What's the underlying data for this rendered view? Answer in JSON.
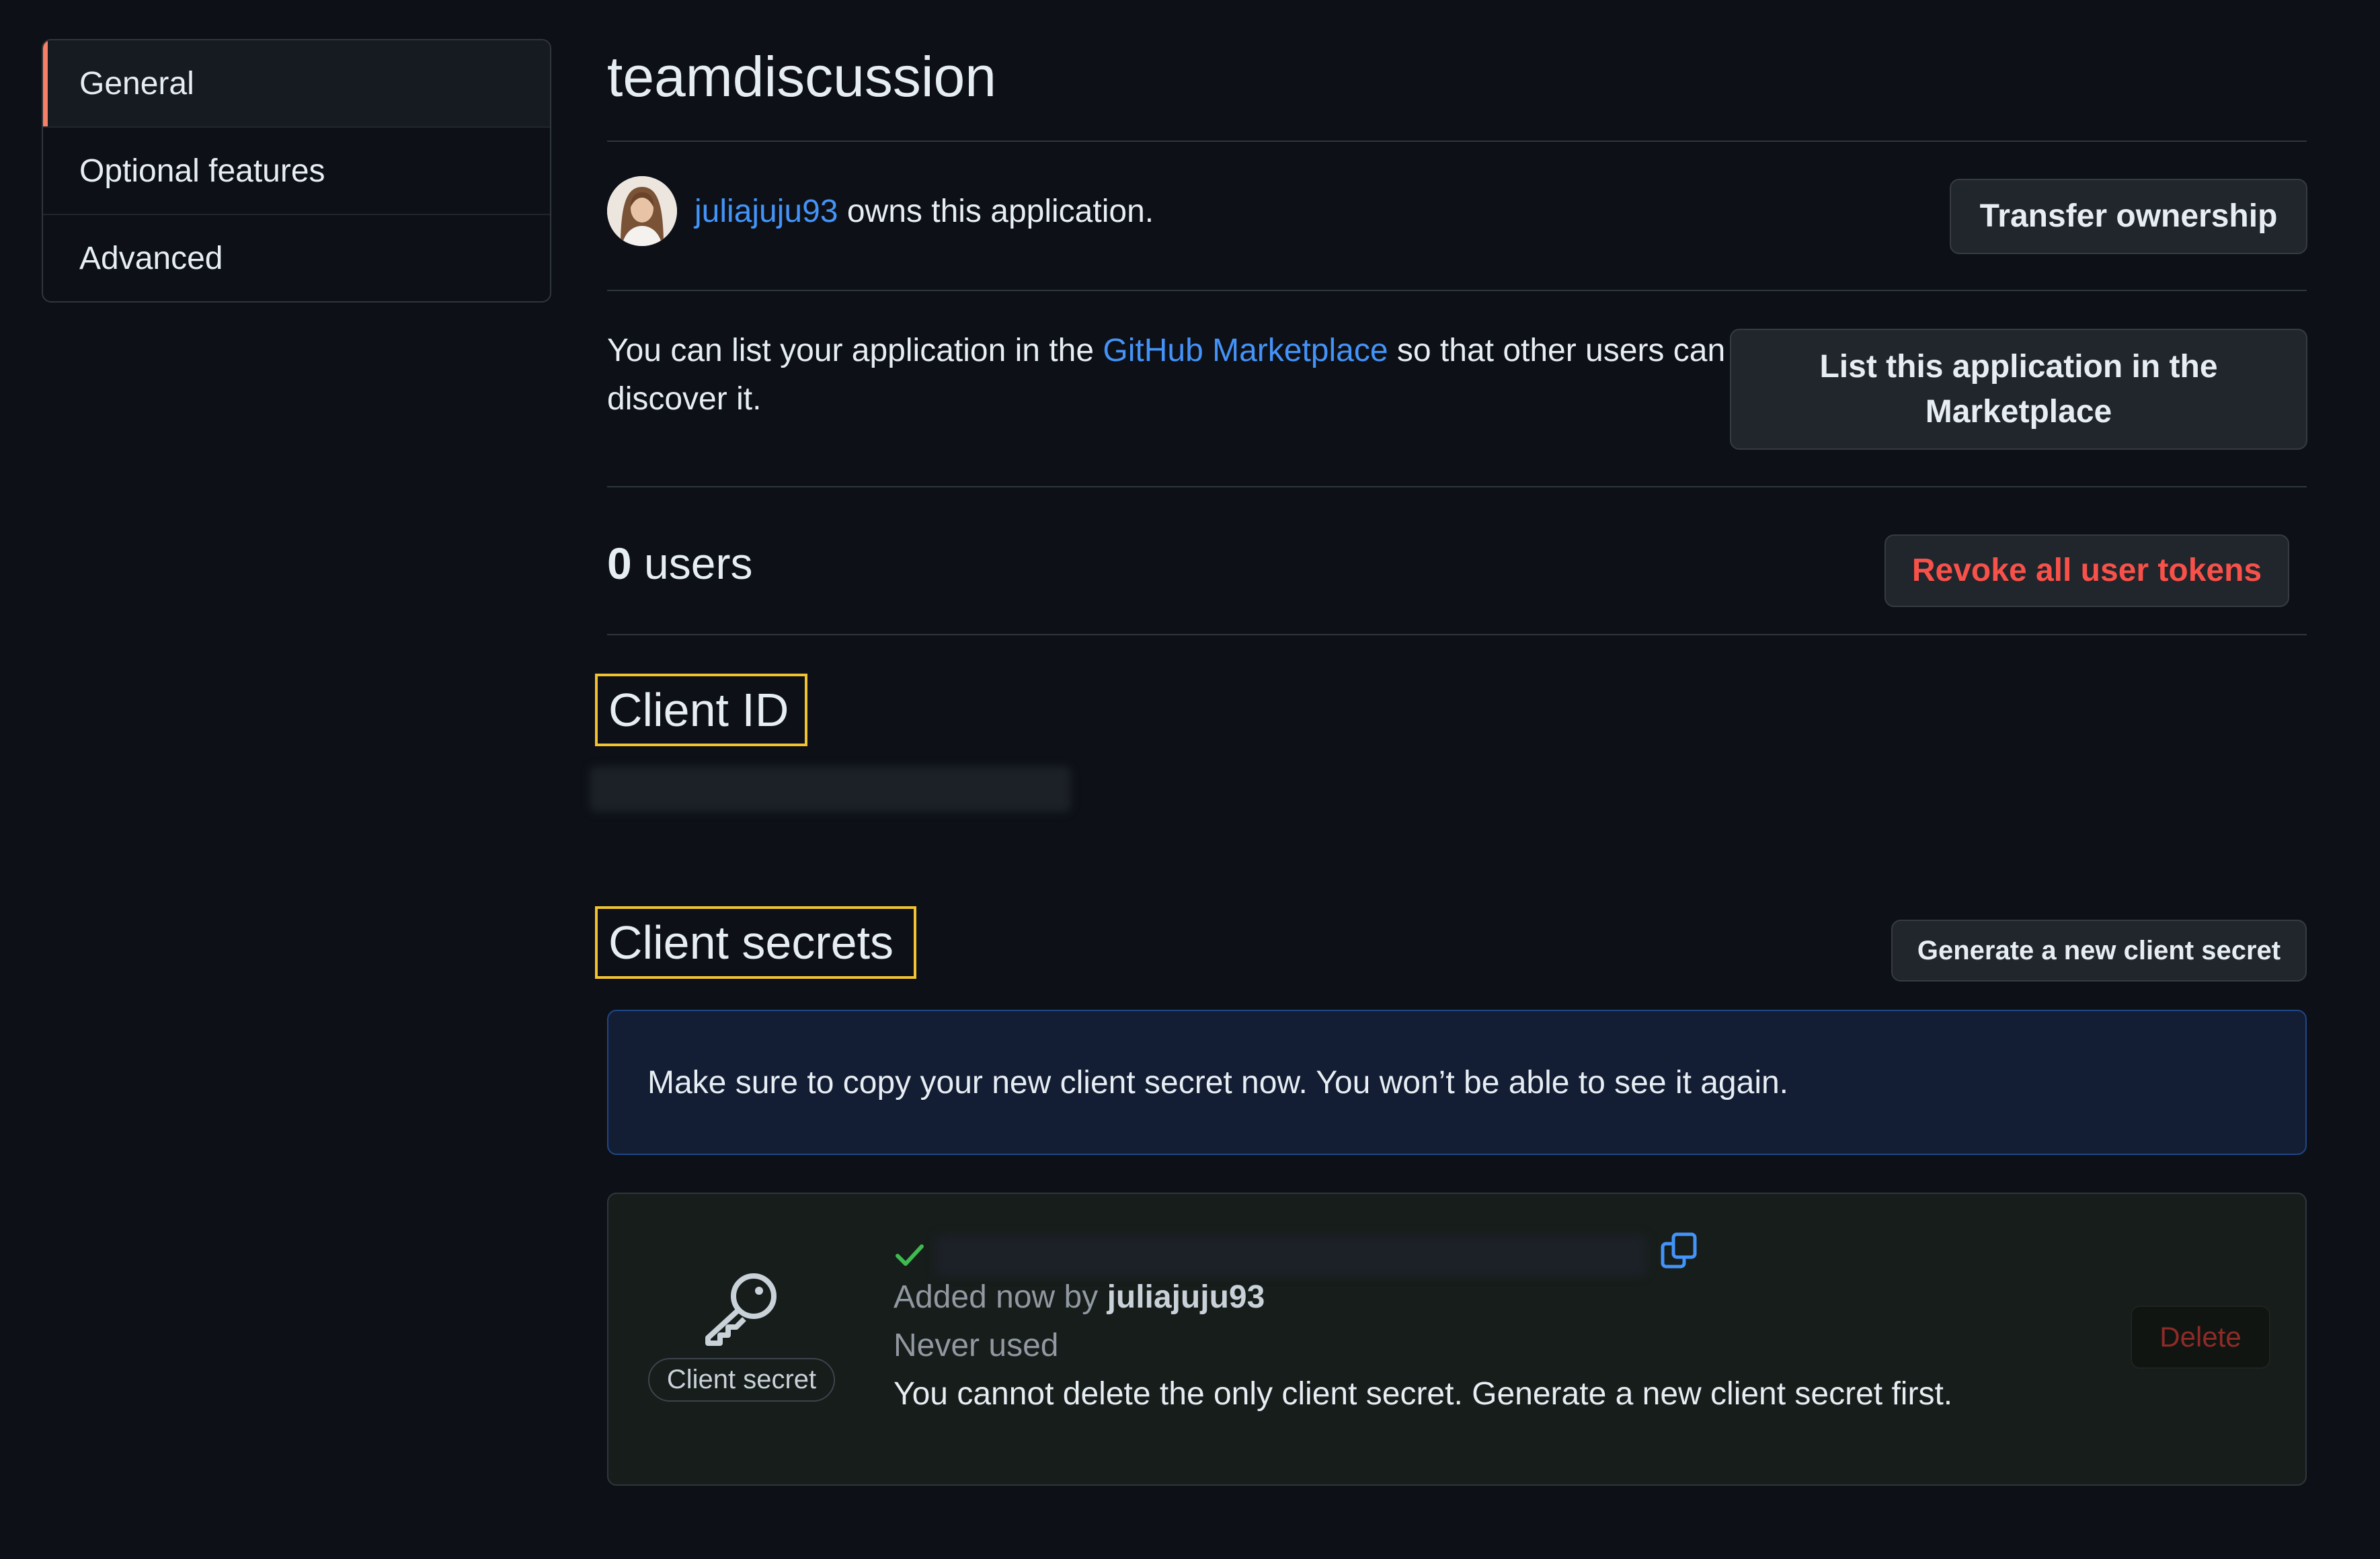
{
  "sidebar": {
    "items": [
      {
        "label": "General"
      },
      {
        "label": "Optional features"
      },
      {
        "label": "Advanced"
      }
    ]
  },
  "app": {
    "title": "teamdiscussion"
  },
  "owner": {
    "username": "juliajuju93",
    "suffix": " owns this application.",
    "transfer_button": "Transfer ownership"
  },
  "marketplace": {
    "text_before": "You can list your application in the ",
    "link": "GitHub Marketplace",
    "text_after": " so that other users can discover it.",
    "button": "List this application in the Marketplace"
  },
  "users": {
    "count": "0",
    "label": " users",
    "revoke_button": "Revoke all user tokens"
  },
  "client_id": {
    "heading": "Client ID"
  },
  "client_secrets": {
    "heading": "Client secrets",
    "generate_button": "Generate a new client secret",
    "flash_message": "Make sure to copy your new client secret now. You won’t be able to see it again.",
    "key_label": "Client secret",
    "added_prefix": "Added now by ",
    "added_by": "juliajuju93",
    "usage": "Never used",
    "delete_note": "You cannot delete the only client secret. Generate a new client secret first.",
    "delete_button": "Delete"
  },
  "colors": {
    "background": "#0d1117",
    "accent_link": "#4493f8",
    "danger": "#f85149",
    "highlight": "#f2c230",
    "success": "#3fb950"
  }
}
